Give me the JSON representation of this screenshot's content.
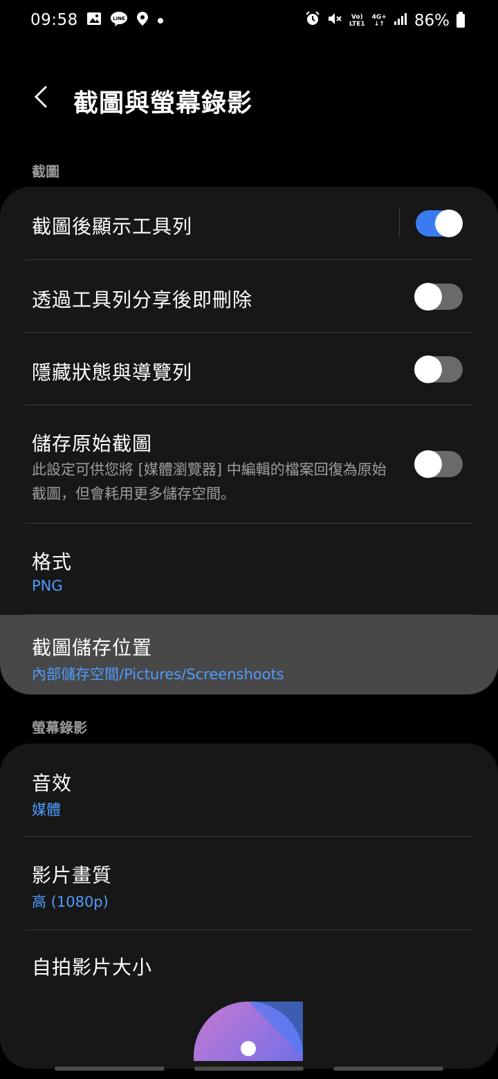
{
  "status": {
    "time": "09:58",
    "net_top": "Vo)",
    "net_bottom": "LTE1",
    "net_type": "4G+",
    "battery": "86%"
  },
  "header": {
    "title": "截圖與螢幕錄影"
  },
  "sections": {
    "screenshot": "截圖",
    "recording": "螢幕錄影"
  },
  "screenshot": {
    "show_toolbar": {
      "label": "截圖後顯示工具列",
      "on": true
    },
    "delete_after_share": {
      "label": "透過工具列分享後即刪除",
      "on": false
    },
    "hide_bars": {
      "label": "隱藏狀態與導覽列",
      "on": false
    },
    "save_original": {
      "label": "儲存原始截圖",
      "desc": "此設定可供您將 [媒體瀏覽器] 中編輯的檔案回復為原始截圖，但會耗用更多儲存空間。",
      "on": false
    },
    "format": {
      "label": "格式",
      "value": "PNG"
    },
    "location": {
      "label": "截圖儲存位置",
      "value": "內部儲存空間/Pictures/Screenshoots"
    }
  },
  "recording": {
    "sound": {
      "label": "音效",
      "value": "媒體"
    },
    "quality": {
      "label": "影片畫質",
      "value": "高 (1080p)"
    },
    "selfie_size": {
      "label": "自拍影片大小"
    }
  },
  "colors": {
    "accent": "#3a7cf0",
    "link": "#4f9cff",
    "card": "#171717"
  }
}
